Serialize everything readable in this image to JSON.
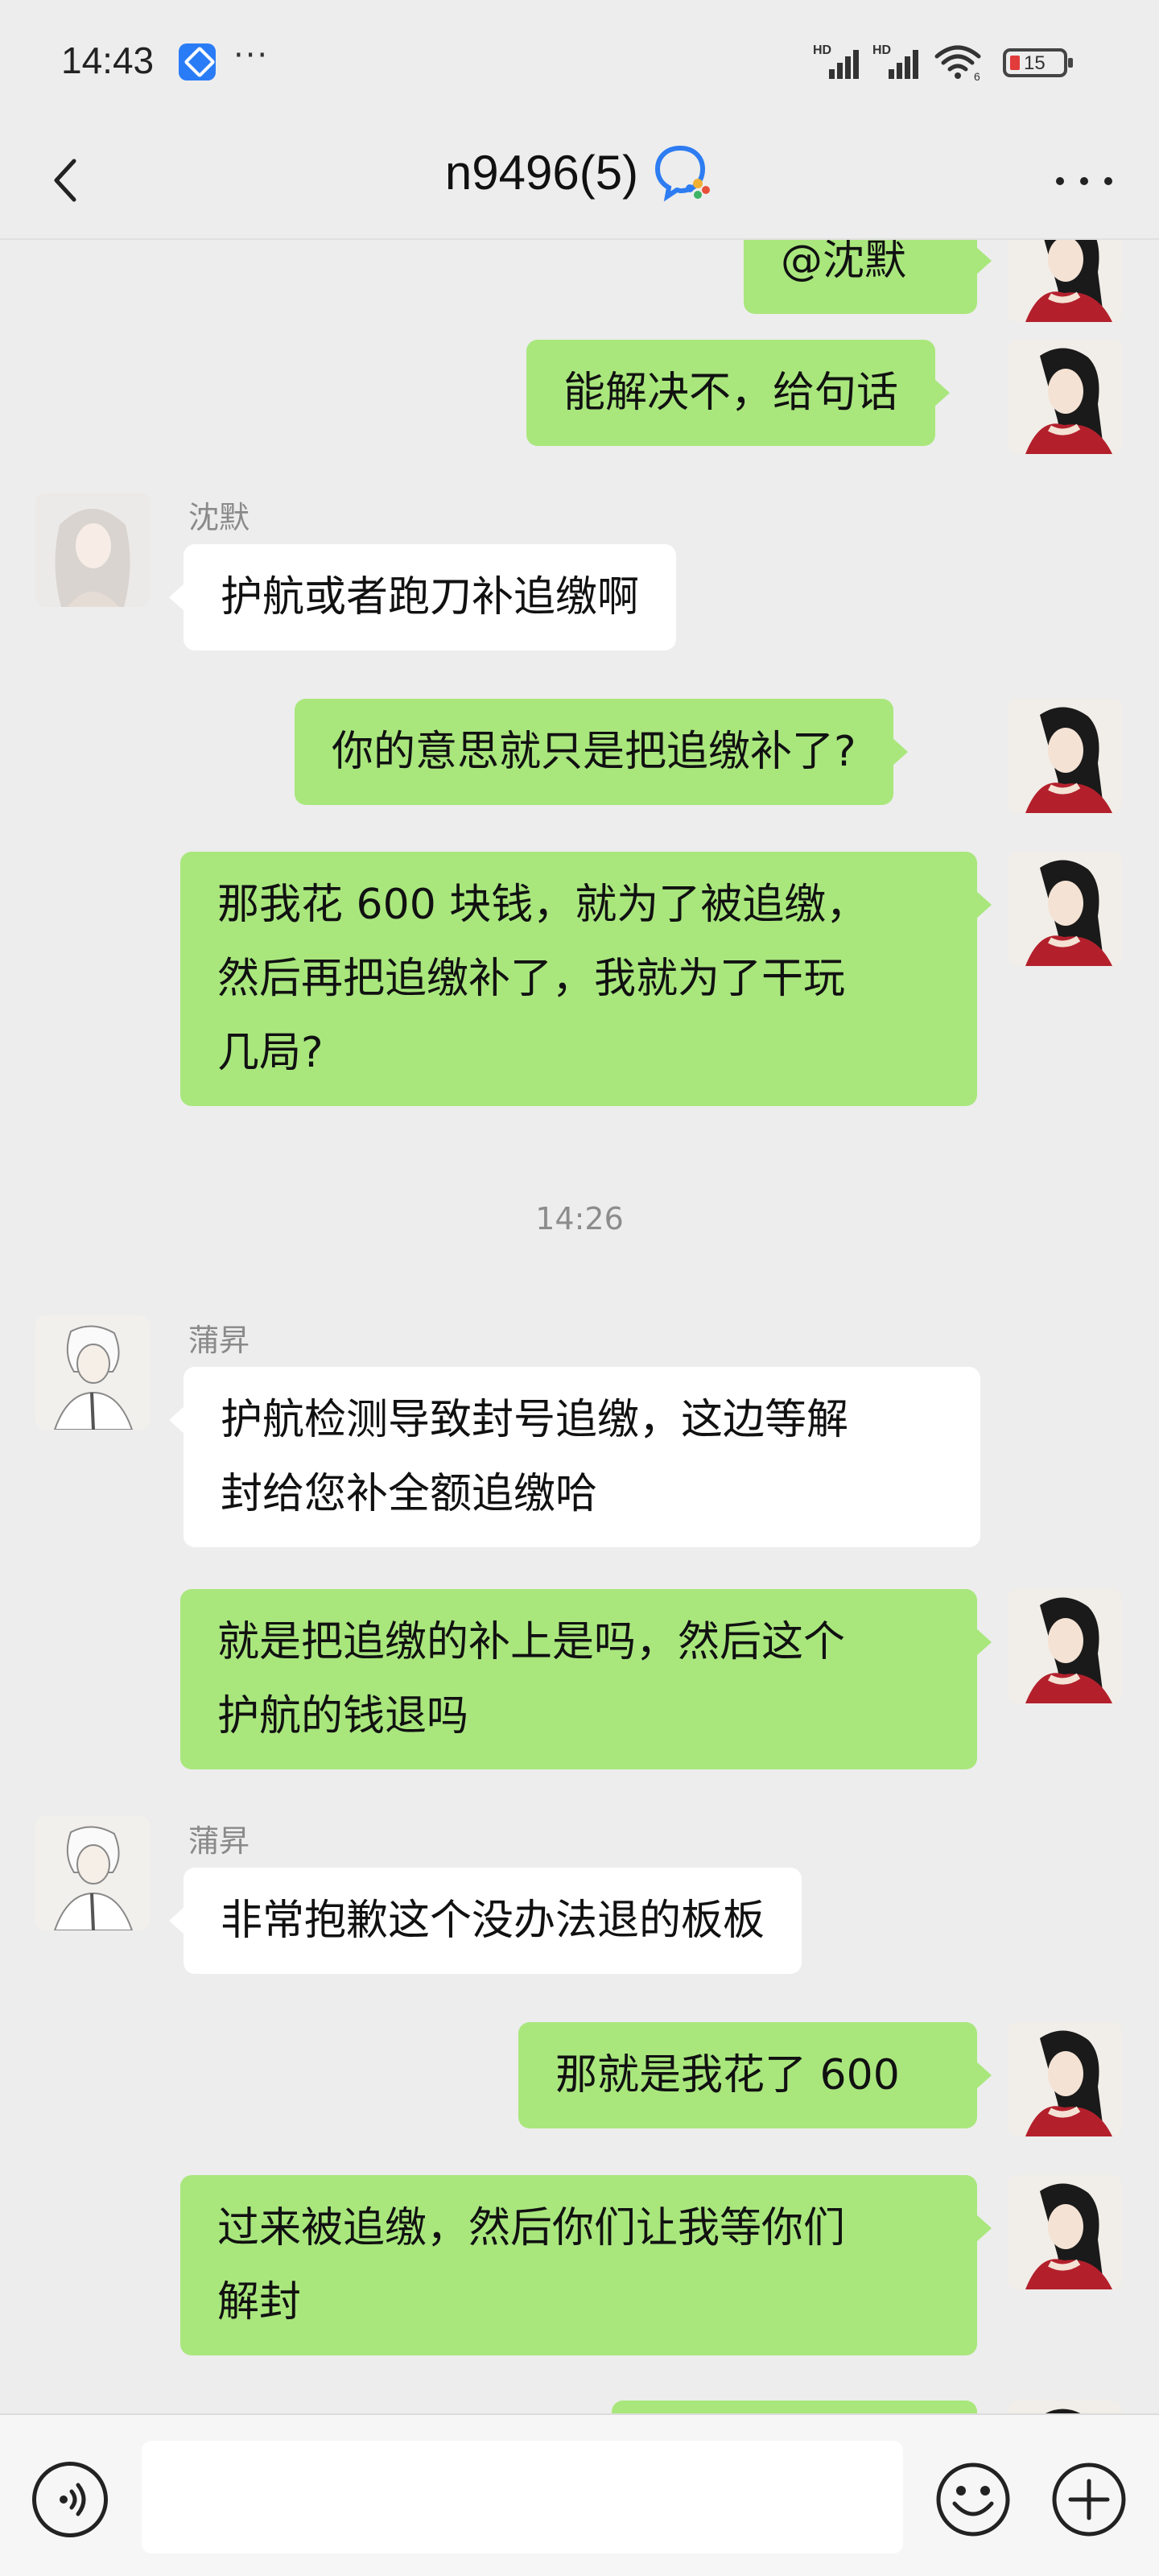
{
  "status_bar": {
    "time": "14:43",
    "more_dots": "···",
    "signal_1_label": "HD",
    "signal_2_label": "HD",
    "wifi_sub": "6",
    "battery": "15"
  },
  "header": {
    "title": "n9496(5)",
    "back_icon": "chevron-left-icon",
    "more_icon": "more-horizontal-icon",
    "badge_icon": "enterprise-chat-icon"
  },
  "colors": {
    "outgoing_bubble": "#a9e77d",
    "incoming_bubble": "#ffffff",
    "background": "#ededed"
  },
  "messages": [
    {
      "side": "out",
      "text": "@沈默"
    },
    {
      "side": "out",
      "text": "能解决不，给句话"
    },
    {
      "side": "in",
      "sender": "沈默",
      "text": "护航或者跑刀补追缴啊"
    },
    {
      "side": "out",
      "text": "你的意思就只是把追缴补了?"
    },
    {
      "side": "out",
      "lines": [
        "那我花 600 块钱，就为了被追缴，",
        "然后再把追缴补了，我就为了干玩",
        "几局?"
      ]
    },
    {
      "side": "in",
      "sender": "蒲昇",
      "lines": [
        "护航检测导致封号追缴，这边等解",
        "封给您补全额追缴哈"
      ]
    },
    {
      "side": "out",
      "lines": [
        "就是把追缴的补上是吗，然后这个",
        "护航的钱退吗"
      ]
    },
    {
      "side": "in",
      "sender": "蒲昇",
      "text": "非常抱歉这个没办法退的板板"
    },
    {
      "side": "out",
      "text": "那就是我花了 600"
    },
    {
      "side": "out",
      "lines": [
        "过来被追缴，然后你们让我等你们",
        "解封"
      ]
    }
  ],
  "time_divider": "14:26",
  "input_bar": {
    "placeholder": "",
    "voice_icon": "voice-icon",
    "emoji_icon": "emoji-icon",
    "plus_icon": "plus-icon"
  }
}
